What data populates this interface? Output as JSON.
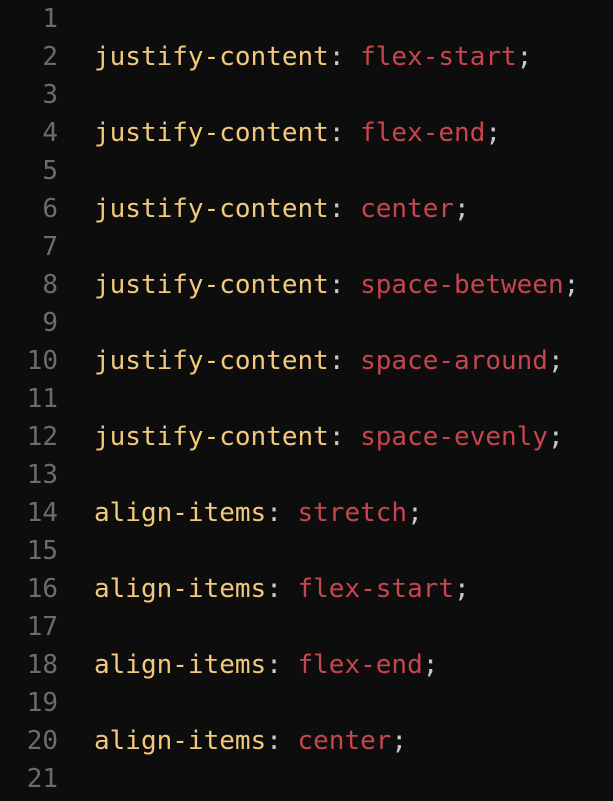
{
  "editor": {
    "lines": [
      {
        "num": "1",
        "prop": "",
        "colon": "",
        "val": "",
        "semi": ""
      },
      {
        "num": "2",
        "prop": "justify-content",
        "colon": ": ",
        "val": "flex-start",
        "semi": ";"
      },
      {
        "num": "3",
        "prop": "",
        "colon": "",
        "val": "",
        "semi": ""
      },
      {
        "num": "4",
        "prop": "justify-content",
        "colon": ": ",
        "val": "flex-end",
        "semi": ";"
      },
      {
        "num": "5",
        "prop": "",
        "colon": "",
        "val": "",
        "semi": ""
      },
      {
        "num": "6",
        "prop": "justify-content",
        "colon": ": ",
        "val": "center",
        "semi": ";"
      },
      {
        "num": "7",
        "prop": "",
        "colon": "",
        "val": "",
        "semi": ""
      },
      {
        "num": "8",
        "prop": "justify-content",
        "colon": ": ",
        "val": "space-between",
        "semi": ";"
      },
      {
        "num": "9",
        "prop": "",
        "colon": "",
        "val": "",
        "semi": ""
      },
      {
        "num": "10",
        "prop": "justify-content",
        "colon": ": ",
        "val": "space-around",
        "semi": ";"
      },
      {
        "num": "11",
        "prop": "",
        "colon": "",
        "val": "",
        "semi": ""
      },
      {
        "num": "12",
        "prop": "justify-content",
        "colon": ": ",
        "val": "space-evenly",
        "semi": ";"
      },
      {
        "num": "13",
        "prop": "",
        "colon": "",
        "val": "",
        "semi": ""
      },
      {
        "num": "14",
        "prop": "align-items",
        "colon": ": ",
        "val": "stretch",
        "semi": ";"
      },
      {
        "num": "15",
        "prop": "",
        "colon": "",
        "val": "",
        "semi": ""
      },
      {
        "num": "16",
        "prop": "align-items",
        "colon": ": ",
        "val": "flex-start",
        "semi": ";"
      },
      {
        "num": "17",
        "prop": "",
        "colon": "",
        "val": "",
        "semi": ""
      },
      {
        "num": "18",
        "prop": "align-items",
        "colon": ": ",
        "val": "flex-end",
        "semi": ";"
      },
      {
        "num": "19",
        "prop": "",
        "colon": "",
        "val": "",
        "semi": ""
      },
      {
        "num": "20",
        "prop": "align-items",
        "colon": ": ",
        "val": "center",
        "semi": ";"
      },
      {
        "num": "21",
        "prop": "",
        "colon": "",
        "val": "",
        "semi": ""
      }
    ]
  },
  "colors": {
    "background": "#0d0d0d",
    "line_number": "#6c6c6c",
    "property": "#f2c97a",
    "value": "#c7454d",
    "punctuation": "#c8c8c8"
  }
}
